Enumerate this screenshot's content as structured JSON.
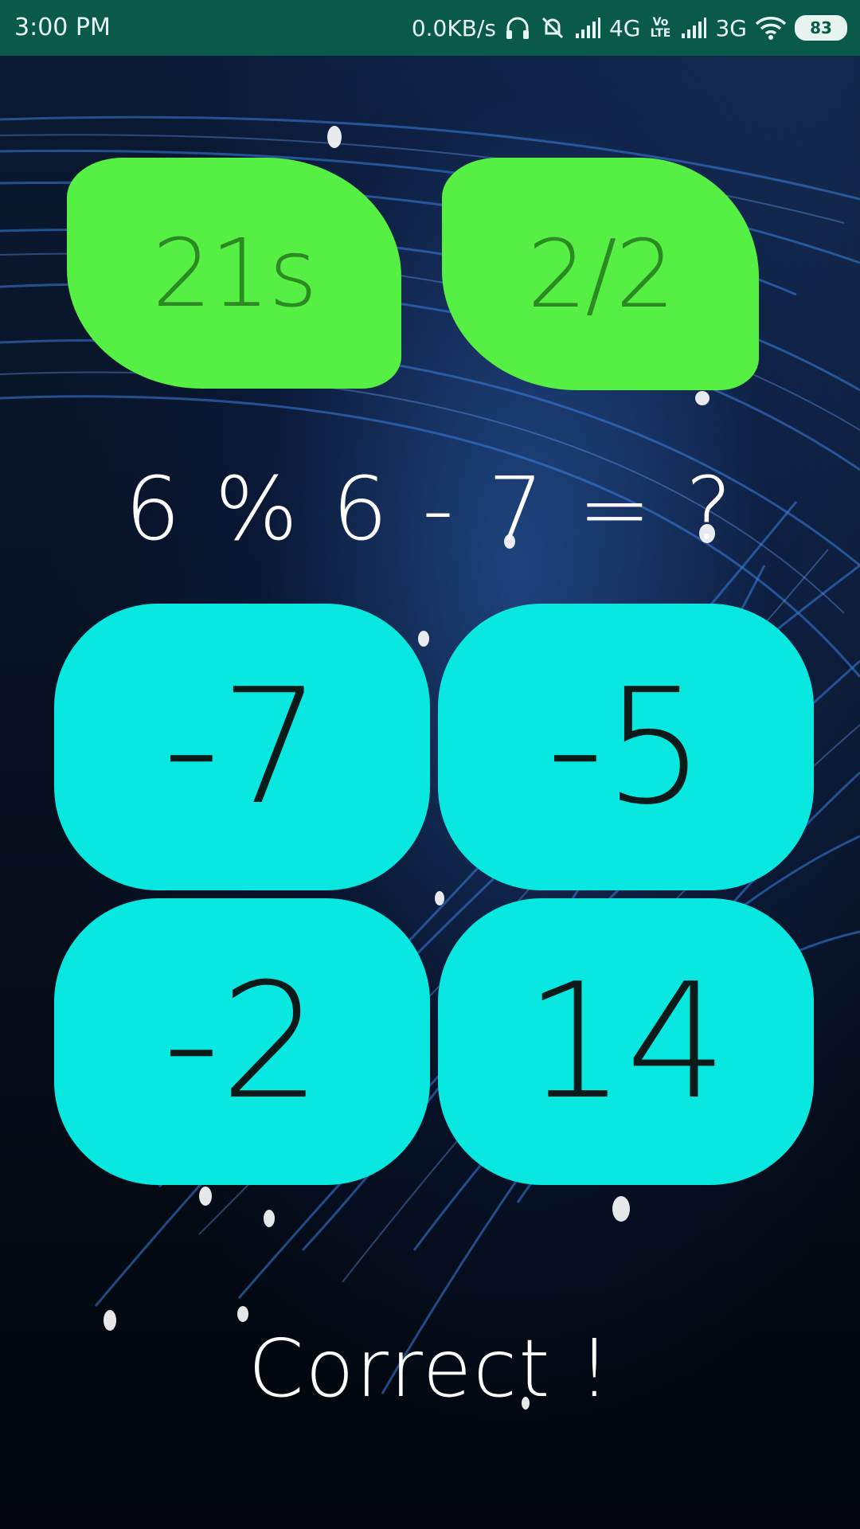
{
  "status_bar": {
    "time": "3:00 PM",
    "speed": "0.0KB/s",
    "network1": "4G",
    "volte": "Vo LTE",
    "network2": "3G",
    "battery": "83",
    "icons": [
      "headphones-icon",
      "mute-icon",
      "signal-icon",
      "volte-icon",
      "signal-icon",
      "wifi-icon",
      "battery-icon"
    ]
  },
  "game": {
    "timer": "21s",
    "progress": "2/2",
    "question": "6 % 6 - 7 = ?",
    "answers": [
      "-7",
      "-5",
      "-2",
      "14"
    ],
    "feedback": "Correct !"
  },
  "colors": {
    "status_bar": "#0a5a4a",
    "badge": "#56f045",
    "badge_text": "#2c8a23",
    "answer_button": "#08e8e0",
    "answer_text": "#0d1a1a"
  }
}
